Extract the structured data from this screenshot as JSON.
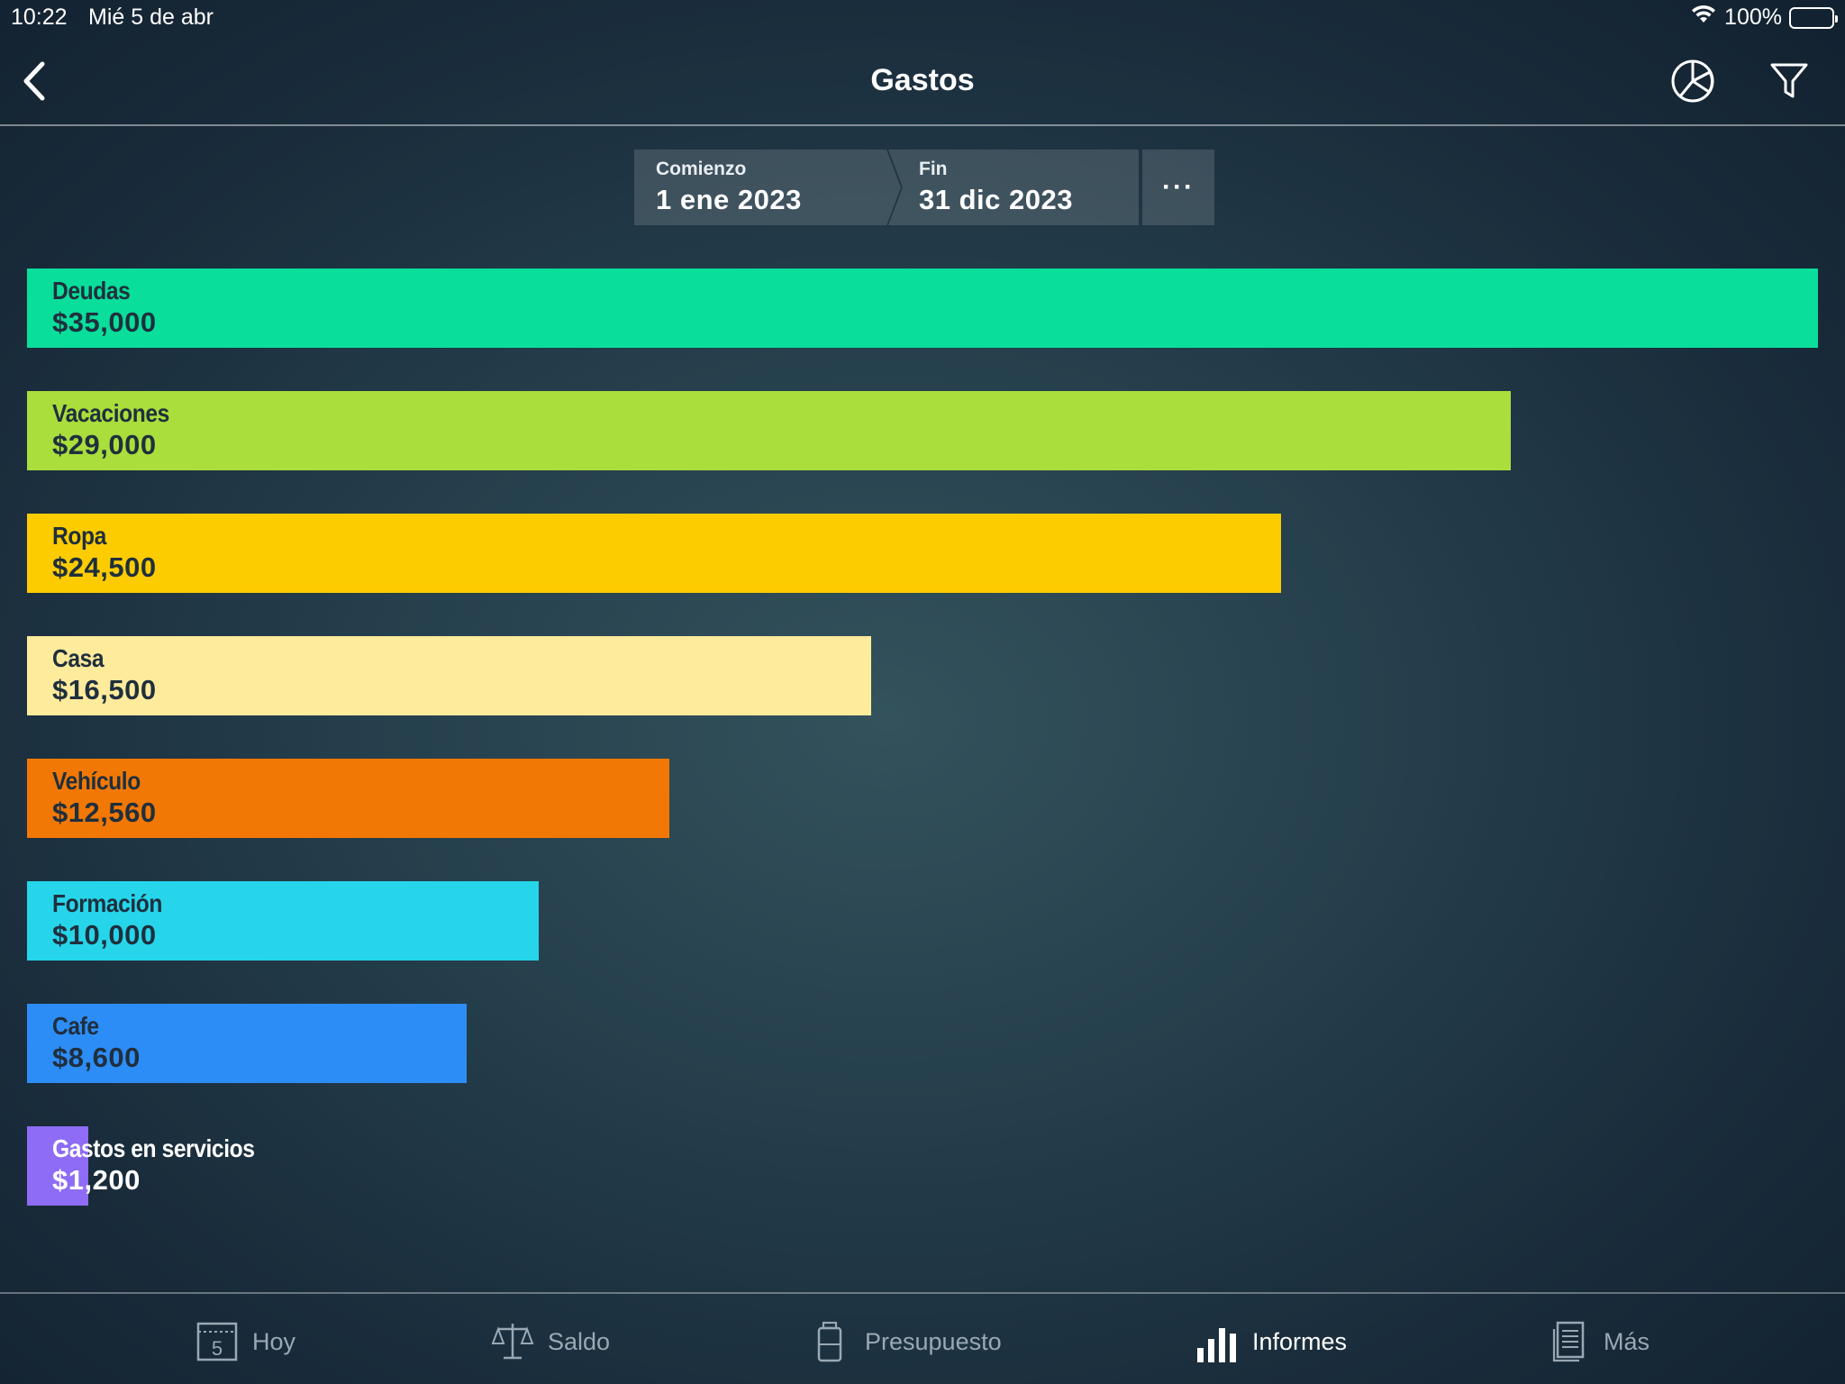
{
  "status": {
    "time": "10:22",
    "date": "Mié 5 de abr",
    "battery": "100%"
  },
  "nav": {
    "title": "Gastos",
    "back_icon": "chevron-left-icon",
    "chart_type_icon": "pie-chart-icon",
    "filter_icon": "filter-icon"
  },
  "date_range": {
    "start_caption": "Comienzo",
    "start_value": "1 ene 2023",
    "end_caption": "Fin",
    "end_value": "31 dic 2023",
    "more_label": "···"
  },
  "chart_data": {
    "type": "bar",
    "orientation": "horizontal",
    "categories": [
      "Deudas",
      "Vacaciones",
      "Ropa",
      "Casa",
      "Vehículo",
      "Formación",
      "Cafe",
      "Gastos en servicios"
    ],
    "values": [
      35000,
      29000,
      24500,
      16500,
      12560,
      10000,
      8600,
      1200
    ],
    "value_labels": [
      "$35,000",
      "$29,000",
      "$24,500",
      "$16,500",
      "$12,560",
      "$10,000",
      "$8,600",
      "$1,200"
    ],
    "colors": [
      "#0ade9b",
      "#a9de3c",
      "#fdcc00",
      "#ffeb9c",
      "#f27805",
      "#26d5ea",
      "#2d8df7",
      "#8e6cf5"
    ],
    "xlim": [
      0,
      35000
    ]
  },
  "tabs": [
    {
      "label": "Hoy",
      "icon": "calendar-icon",
      "icon_text": "5",
      "active": false
    },
    {
      "label": "Saldo",
      "icon": "scale-icon",
      "active": false
    },
    {
      "label": "Presupuesto",
      "icon": "jar-icon",
      "active": false
    },
    {
      "label": "Informes",
      "icon": "bar-chart-icon",
      "active": true
    },
    {
      "label": "Más",
      "icon": "document-icon",
      "active": false
    }
  ]
}
